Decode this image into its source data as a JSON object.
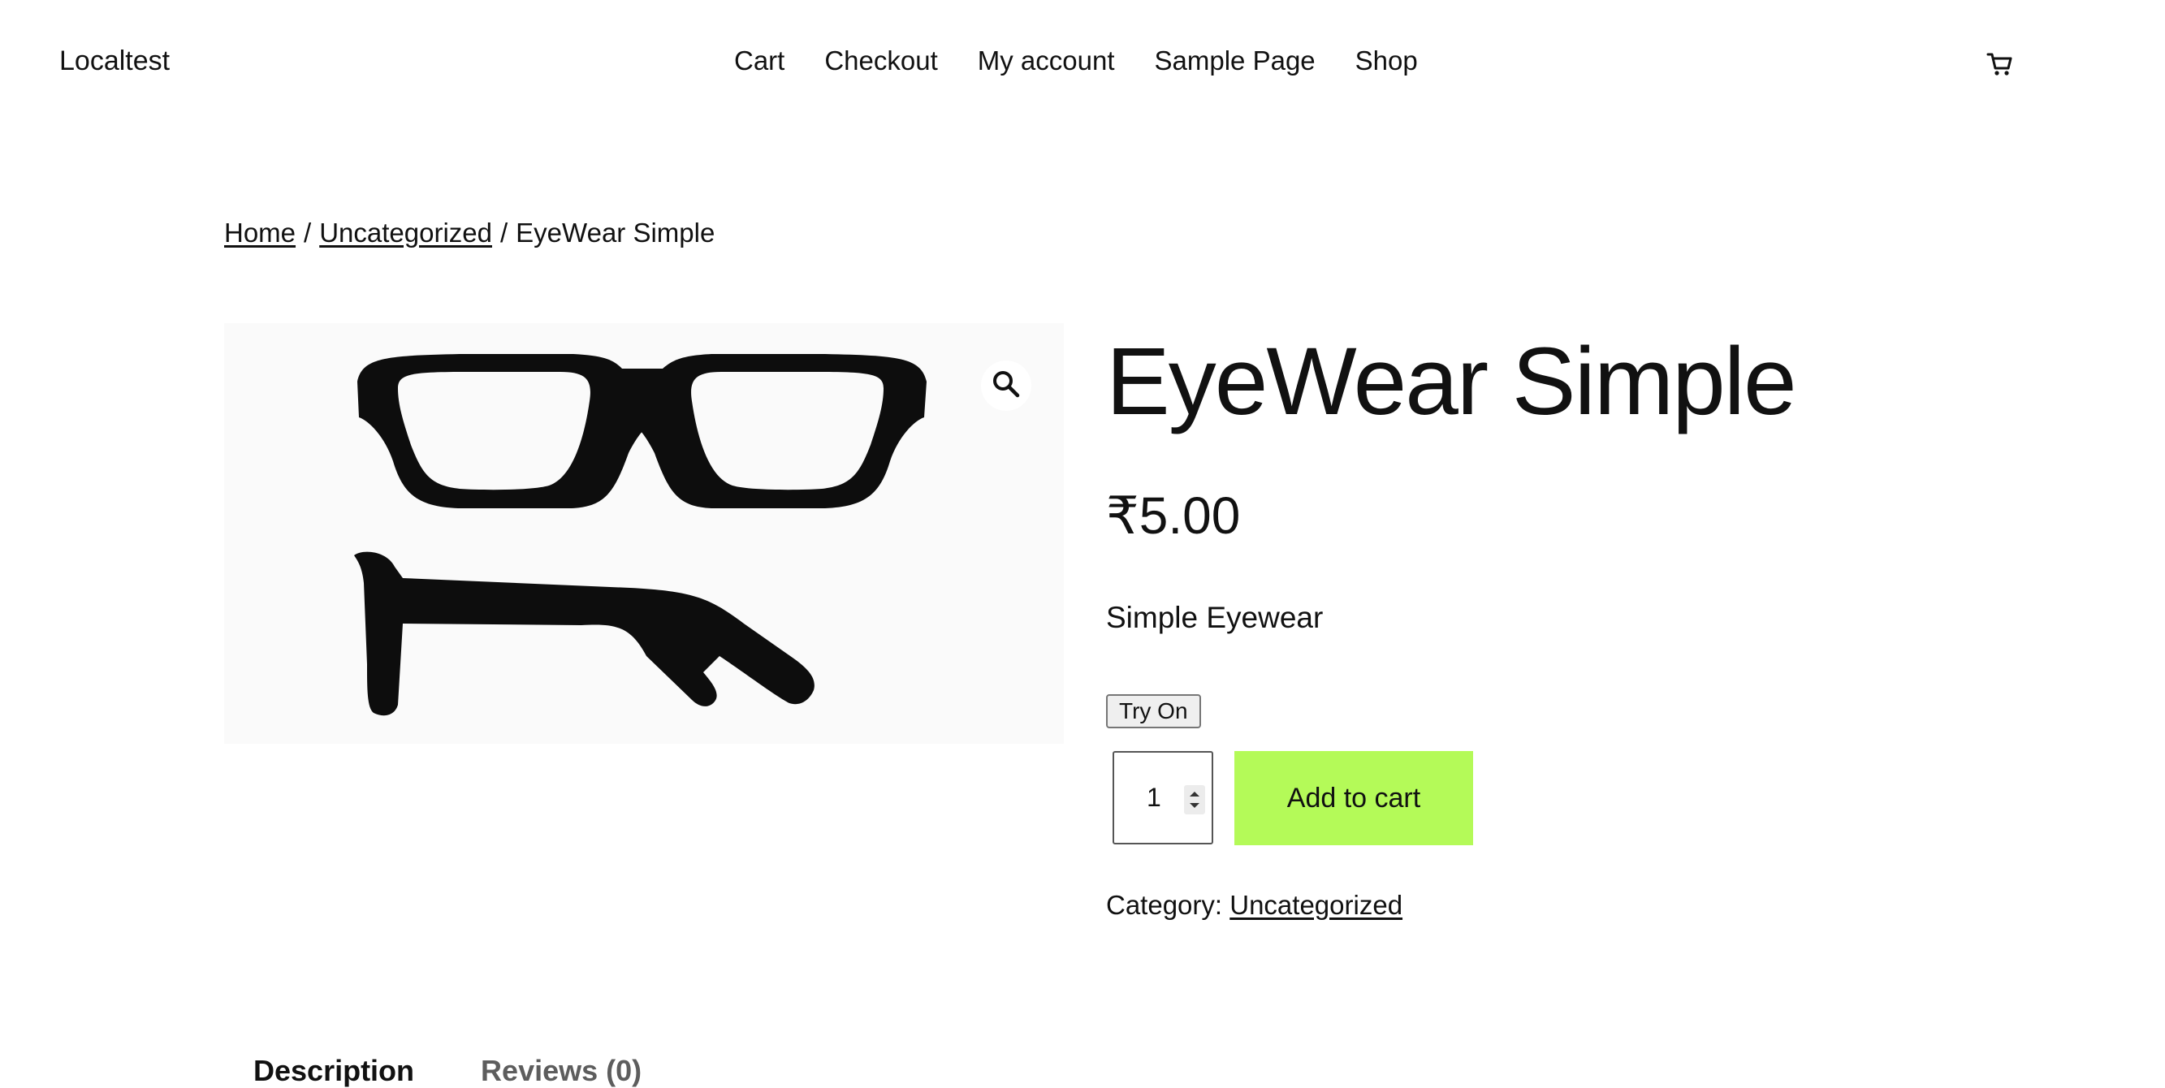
{
  "header": {
    "site_title": "Localtest",
    "nav": [
      "Cart",
      "Checkout",
      "My account",
      "Sample Page",
      "Shop"
    ],
    "cart_icon": "cart-icon"
  },
  "breadcrumb": {
    "home": "Home",
    "category": "Uncategorized",
    "current": "EyeWear Simple",
    "separator": "/"
  },
  "product": {
    "title": "EyeWear Simple",
    "price": "₹5.00",
    "short_description": "Simple Eyewear",
    "try_on_label": "Try On",
    "quantity": "1",
    "add_to_cart_label": "Add to cart",
    "category_label": "Category:",
    "category": "Uncategorized",
    "zoom_icon": "magnifier-icon"
  },
  "tabs": [
    {
      "label": "Description",
      "active": true
    },
    {
      "label": "Reviews (0)",
      "active": false
    }
  ],
  "colors": {
    "add_to_cart_bg": "#b4fa58",
    "text": "#111111"
  }
}
